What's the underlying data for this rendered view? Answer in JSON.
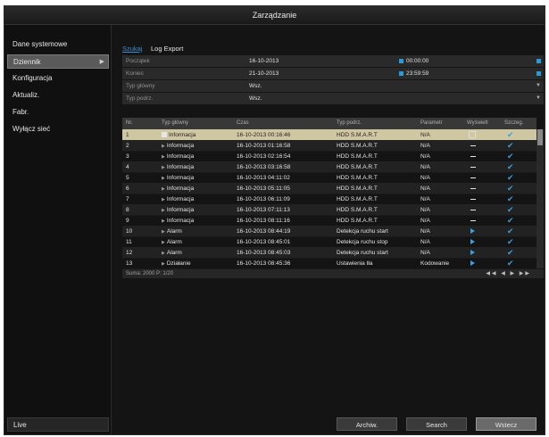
{
  "window": {
    "title": "Zarządzanie"
  },
  "sidebar": {
    "items": [
      {
        "label": "Dane systemowe"
      },
      {
        "label": "Dziennik"
      },
      {
        "label": "Konfiguracja"
      },
      {
        "label": "Aktualiz."
      },
      {
        "label": "Fabr."
      },
      {
        "label": "Wyłącz sieć"
      }
    ],
    "live_label": "Live"
  },
  "tabs": [
    {
      "label": "Szukaj"
    },
    {
      "label": "Log Export"
    }
  ],
  "filters": {
    "start": {
      "label": "Początek",
      "date": "16-10-2013",
      "time": "00:00:00"
    },
    "end": {
      "label": "Koniec",
      "date": "21-10-2013",
      "time": "23:59:59"
    },
    "major": {
      "label": "Typ główny",
      "value": "Wsz."
    },
    "minor": {
      "label": "Typ podrz.",
      "value": "Wsz."
    }
  },
  "table": {
    "columns": [
      "Nr.",
      "Typ główny",
      "Czas",
      "Typ podrz.",
      "Parametr",
      "Wyświetl",
      "Szczeg."
    ],
    "rows": [
      {
        "no": "1",
        "major": "Informacja",
        "time": "16-10-2013 00:16:46",
        "minor": "HDD S.M.A.R.T",
        "param": "N/A",
        "play": "box"
      },
      {
        "no": "2",
        "major": "Informacja",
        "time": "16-10-2013 01:16:58",
        "minor": "HDD S.M.A.R.T",
        "param": "N/A",
        "play": "dash"
      },
      {
        "no": "3",
        "major": "Informacja",
        "time": "16-10-2013 02:16:54",
        "minor": "HDD S.M.A.R.T",
        "param": "N/A",
        "play": "dash"
      },
      {
        "no": "4",
        "major": "Informacja",
        "time": "16-10-2013 03:16:58",
        "minor": "HDD S.M.A.R.T",
        "param": "N/A",
        "play": "dash"
      },
      {
        "no": "5",
        "major": "Informacja",
        "time": "16-10-2013 04:11:02",
        "minor": "HDD S.M.A.R.T",
        "param": "N/A",
        "play": "dash"
      },
      {
        "no": "6",
        "major": "Informacja",
        "time": "16-10-2013 05:11:05",
        "minor": "HDD S.M.A.R.T",
        "param": "N/A",
        "play": "dash"
      },
      {
        "no": "7",
        "major": "Informacja",
        "time": "16-10-2013 06:11:09",
        "minor": "HDD S.M.A.R.T",
        "param": "N/A",
        "play": "dash"
      },
      {
        "no": "8",
        "major": "Informacja",
        "time": "16-10-2013 07:11:13",
        "minor": "HDD S.M.A.R.T",
        "param": "N/A",
        "play": "dash"
      },
      {
        "no": "9",
        "major": "Informacja",
        "time": "16-10-2013 08:11:16",
        "minor": "HDD S.M.A.R.T",
        "param": "N/A",
        "play": "dash"
      },
      {
        "no": "10",
        "major": "Alarm",
        "time": "16-10-2013 08:44:19",
        "minor": "Detekcja ruchu start",
        "param": "N/A",
        "play": "play"
      },
      {
        "no": "11",
        "major": "Alarm",
        "time": "16-10-2013 08:45:01",
        "minor": "Detekcja ruchu stop",
        "param": "N/A",
        "play": "play"
      },
      {
        "no": "12",
        "major": "Alarm",
        "time": "16-10-2013 08:45:03",
        "minor": "Detekcja ruchu start",
        "param": "N/A",
        "play": "play"
      },
      {
        "no": "13",
        "major": "Działanie",
        "time": "16-10-2013 08:45:36",
        "minor": "Ustawienia tła",
        "param": "Kodowanie",
        "play": "play"
      }
    ],
    "footer": "Suma: 2000 P: 1/20"
  },
  "buttons": {
    "archive": "Archiw.",
    "search": "Search",
    "back": "Wstecz"
  },
  "colors": {
    "accent": "#3a8fd8",
    "selected_row": "#cfc7a2"
  }
}
